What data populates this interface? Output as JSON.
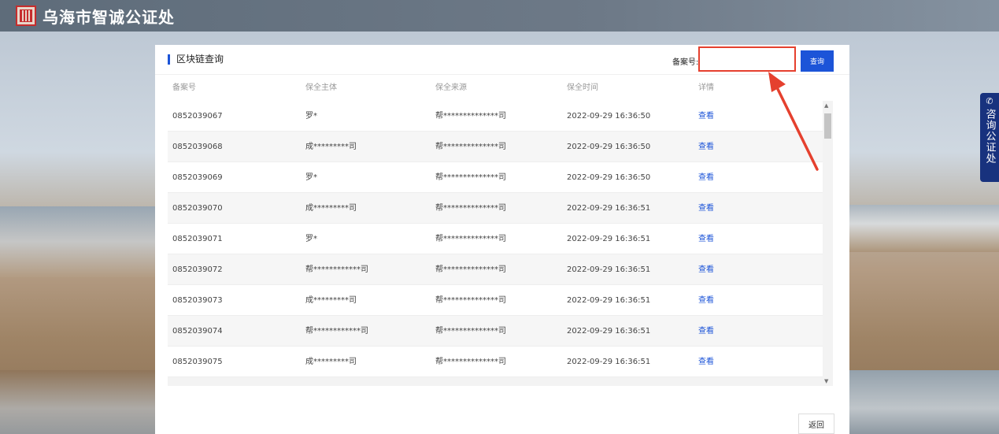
{
  "header": {
    "title": "乌海市智诚公证处"
  },
  "panel": {
    "title": "区块链查询",
    "search": {
      "label": "备案号:",
      "value": "",
      "button_label": "查询"
    },
    "back_label": "返回"
  },
  "table": {
    "columns": [
      "备案号",
      "保全主体",
      "保全来源",
      "保全时间",
      "详情"
    ],
    "rows": [
      {
        "id": "0852039067",
        "subject": "罗*",
        "source": "帮**************司",
        "time": "2022-09-29 16:36:50",
        "detail": "查看"
      },
      {
        "id": "0852039068",
        "subject": "成*********司",
        "source": "帮**************司",
        "time": "2022-09-29 16:36:50",
        "detail": "查看"
      },
      {
        "id": "0852039069",
        "subject": "罗*",
        "source": "帮**************司",
        "time": "2022-09-29 16:36:50",
        "detail": "查看"
      },
      {
        "id": "0852039070",
        "subject": "成*********司",
        "source": "帮**************司",
        "time": "2022-09-29 16:36:51",
        "detail": "查看"
      },
      {
        "id": "0852039071",
        "subject": "罗*",
        "source": "帮**************司",
        "time": "2022-09-29 16:36:51",
        "detail": "查看"
      },
      {
        "id": "0852039072",
        "subject": "帮************司",
        "source": "帮**************司",
        "time": "2022-09-29 16:36:51",
        "detail": "查看"
      },
      {
        "id": "0852039073",
        "subject": "成*********司",
        "source": "帮**************司",
        "time": "2022-09-29 16:36:51",
        "detail": "查看"
      },
      {
        "id": "0852039074",
        "subject": "帮************司",
        "source": "帮**************司",
        "time": "2022-09-29 16:36:51",
        "detail": "查看"
      },
      {
        "id": "0852039075",
        "subject": "成*********司",
        "source": "帮**************司",
        "time": "2022-09-29 16:36:51",
        "detail": "查看"
      }
    ]
  },
  "side_tab": {
    "label": "咨询公证处",
    "icon": "phone-icon"
  },
  "colors": {
    "accent": "#1c54d8",
    "highlight": "#e5402e",
    "side_tab": "#18327e"
  }
}
